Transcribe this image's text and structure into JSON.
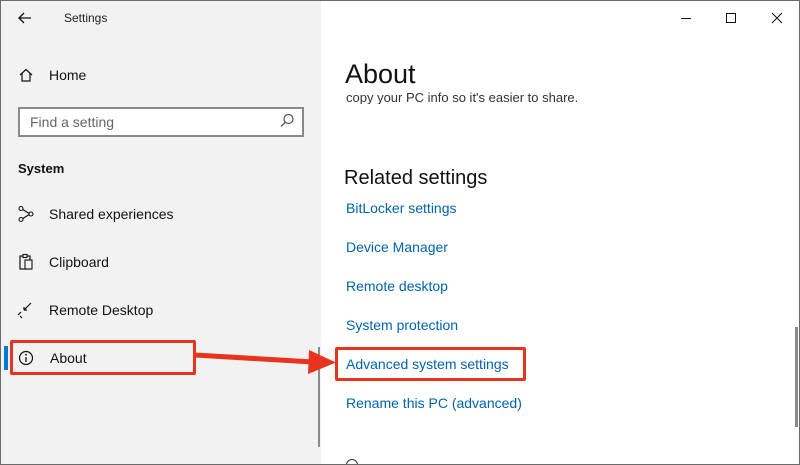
{
  "window": {
    "title": "Settings",
    "controls": {
      "minimize": "minimize",
      "maximize": "maximize",
      "close": "close"
    }
  },
  "sidebar": {
    "home_label": "Home",
    "search_placeholder": "Find a setting",
    "section_heading": "System",
    "items": [
      {
        "label": "Shared experiences",
        "icon": "shared-experiences-icon"
      },
      {
        "label": "Clipboard",
        "icon": "clipboard-icon"
      },
      {
        "label": "Remote Desktop",
        "icon": "remote-desktop-icon"
      },
      {
        "label": "About",
        "icon": "info-icon",
        "selected": true
      }
    ]
  },
  "main": {
    "title": "About",
    "cut_text": "copy your PC info so it's easier to share.",
    "related_heading": "Related settings",
    "links": [
      "BitLocker settings",
      "Device Manager",
      "Remote desktop",
      "System protection",
      "Advanced system settings",
      "Rename this PC (advanced)"
    ]
  },
  "annotations": {
    "highlight_color": "#e8331e",
    "highlighted_targets": [
      "About",
      "Advanced system settings"
    ]
  },
  "colors": {
    "accent": "#0078d7",
    "link": "#0063b1",
    "sidebar_bg": "#f2f2f2"
  }
}
